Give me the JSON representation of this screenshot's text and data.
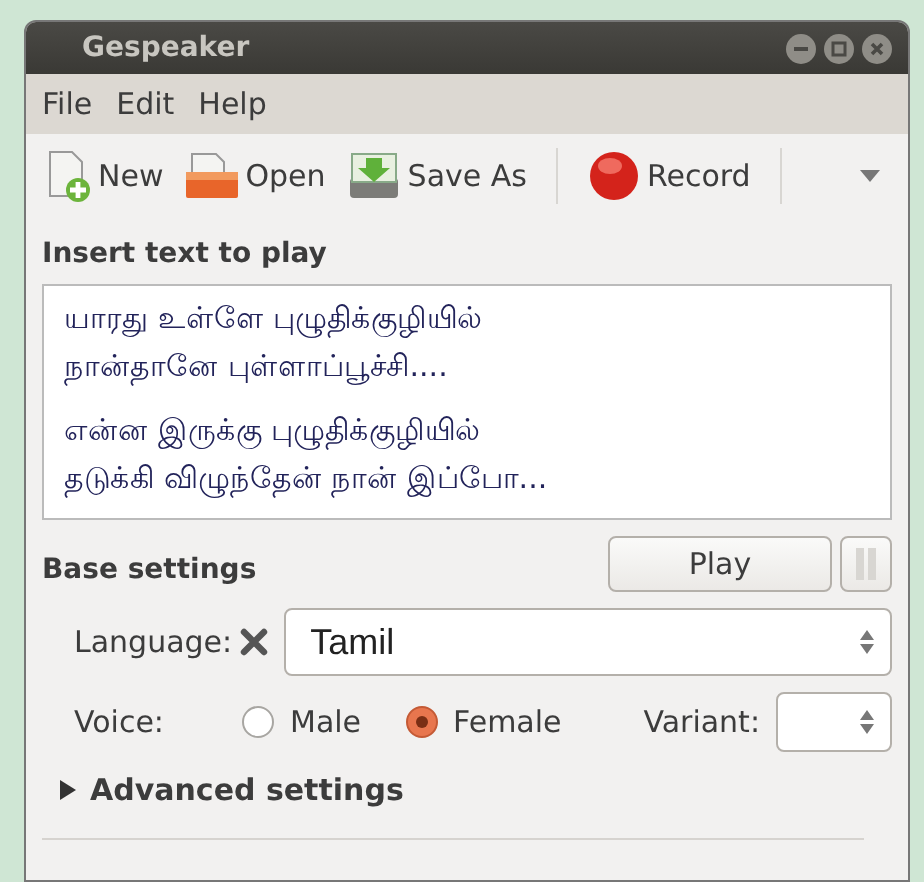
{
  "window": {
    "title": "Gespeaker"
  },
  "menu": [
    "File",
    "Edit",
    "Help"
  ],
  "toolbar": [
    {
      "label": "New",
      "kind": "new"
    },
    {
      "label": "Open",
      "kind": "open"
    },
    {
      "label": "Save As",
      "kind": "save"
    },
    {
      "label": "Record",
      "kind": "record"
    }
  ],
  "text_section": {
    "title": "Insert text to play",
    "paragraphs": [
      [
        "யாரது உள்ளே புழுதிக்குழியில்",
        "நான்தானே புள்ளாப்பூச்சி...."
      ],
      [
        "என்ன இருக்கு புழுதிக்குழியில்",
        "தடுக்கி விழுந்தேன் நான் இப்போ..."
      ]
    ]
  },
  "play_button": {
    "label": "Play"
  },
  "pause_button": {
    "disabled": true
  },
  "base_settings": {
    "title": "Base settings",
    "language_label": "Language:",
    "language": "Tamil",
    "voice_label": "Voice:",
    "voices": [
      {
        "label": "Male",
        "selected": false
      },
      {
        "label": "Female",
        "selected": true
      }
    ],
    "variant_label": "Variant:"
  },
  "advanced": {
    "label": "Advanced settings",
    "expanded": false
  }
}
